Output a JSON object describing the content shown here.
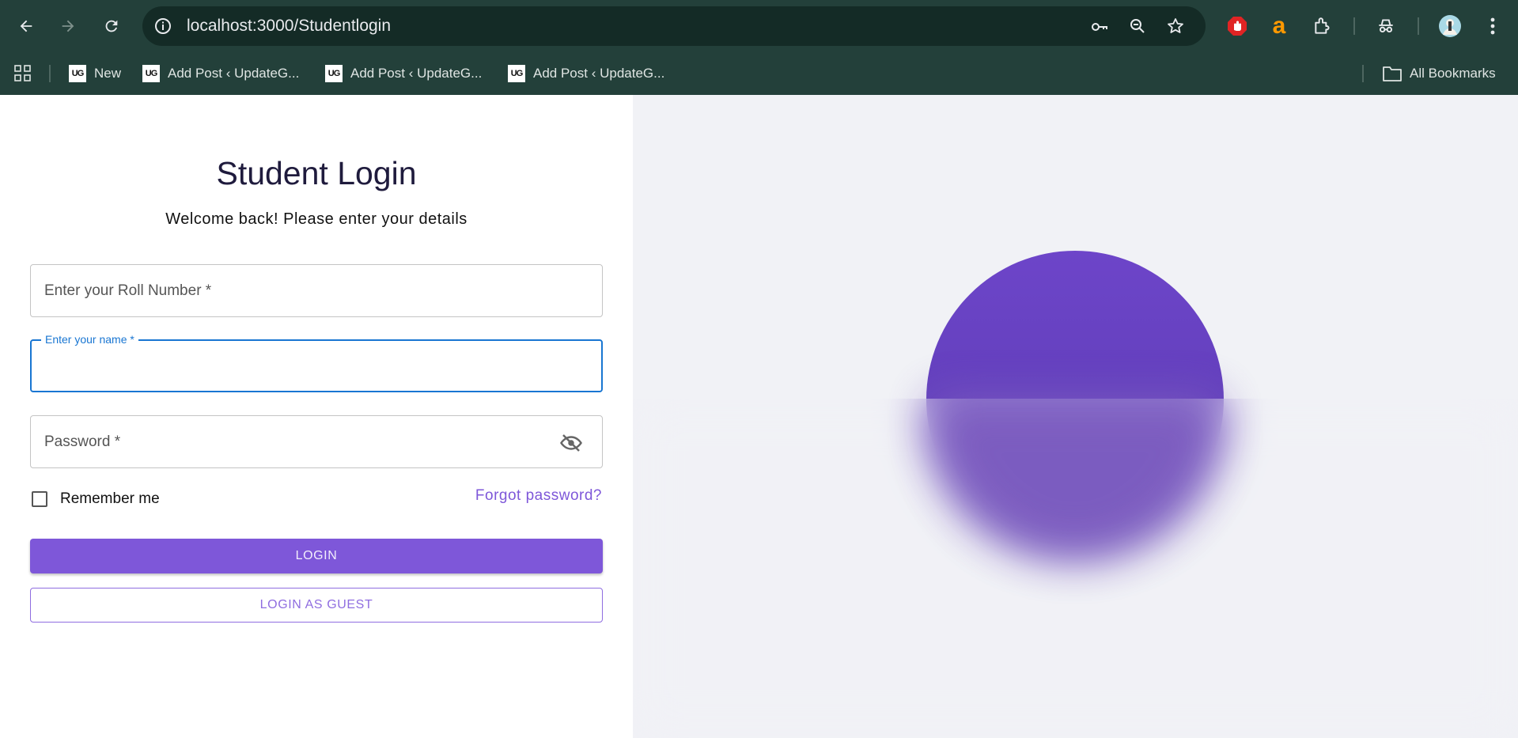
{
  "browser": {
    "url": "localhost:3000/Studentlogin",
    "bookmarks": [
      {
        "label": "New",
        "favicon": "UG"
      },
      {
        "label": "Add Post ‹ UpdateG...",
        "favicon": "UG"
      },
      {
        "label": "Add Post ‹ UpdateG...",
        "favicon": "UG"
      },
      {
        "label": "Add Post ‹ UpdateG...",
        "favicon": "UG"
      }
    ],
    "all_bookmarks_label": "All Bookmarks",
    "extension_letter": "a",
    "colors": {
      "toolbar": "#23403a",
      "omnibox": "#142b26"
    }
  },
  "login": {
    "title": "Student Login",
    "subtitle": "Welcome back! Please enter your details",
    "roll_number_label": "Enter your Roll Number *",
    "name_label": "Enter your name *",
    "name_value": "",
    "password_label": "Password *",
    "remember_label": "Remember me",
    "remember_checked": false,
    "forgot_label": "Forgot password?",
    "login_button": "LOGIN",
    "guest_button": "LOGIN AS GUEST"
  },
  "colors": {
    "accent": "#7e57d9",
    "focus": "#1976d2",
    "right_panel": "#f1f2f6",
    "orb": "#6d45c9"
  },
  "icons": [
    "back-arrow-icon",
    "forward-arrow-icon",
    "reload-icon",
    "info-icon",
    "key-icon",
    "zoom-icon",
    "star-icon",
    "adblock-icon",
    "amazon-icon",
    "extensions-icon",
    "incognito-icon",
    "avatar",
    "more-icon",
    "apps-grid-icon",
    "folder-icon",
    "eye-off-icon"
  ]
}
